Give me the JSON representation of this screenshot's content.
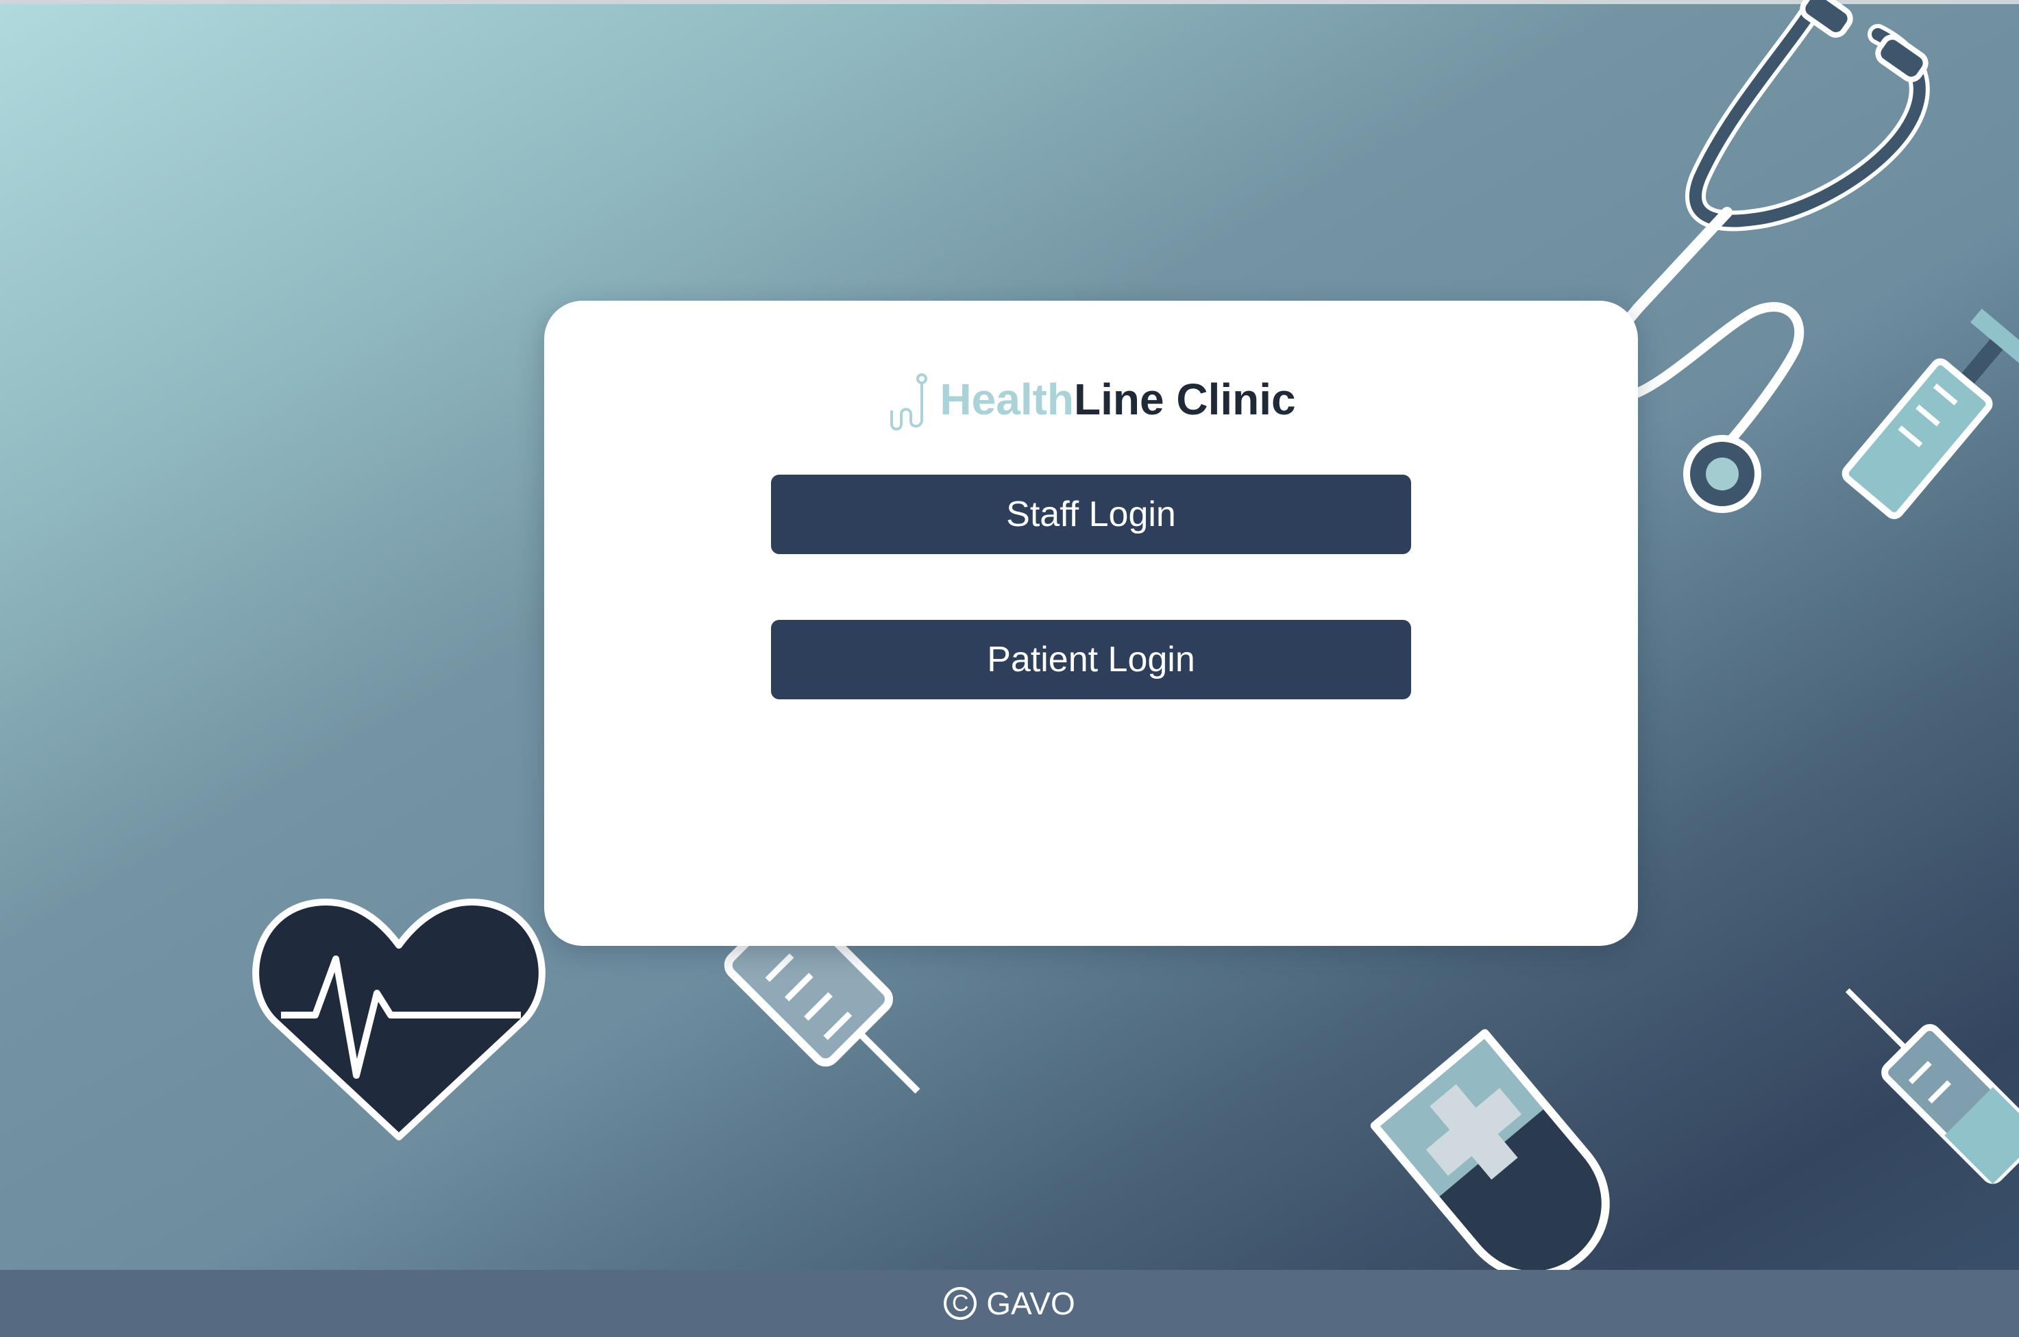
{
  "brand": {
    "name_part1": "Health",
    "name_part2": "Line Clinic",
    "logo_icon": "stethoscope-logo-icon"
  },
  "actions": {
    "staff_login_label": "Staff Login",
    "patient_login_label": "Patient Login"
  },
  "footer": {
    "copyright_symbol": "C",
    "copyright_text": "GAVO"
  },
  "decorations": [
    "stethoscope-icon",
    "syringe-icon",
    "heart-pulse-icon",
    "iv-bag-icon"
  ],
  "colors": {
    "button_bg": "#2d3f5a",
    "brand_accent": "#a9d3d8",
    "brand_dark": "#1f2937",
    "footer_bg": "#566a81",
    "card_bg": "#ffffff"
  }
}
